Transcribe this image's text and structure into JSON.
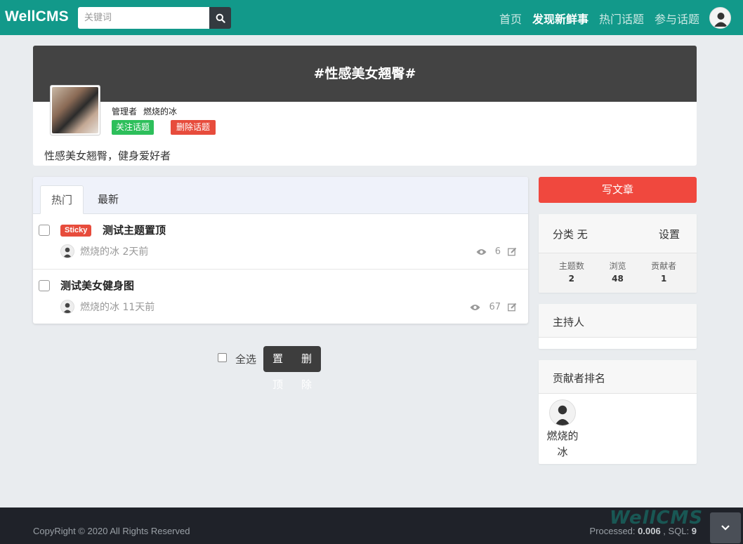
{
  "nav": {
    "brand": "WellCMS",
    "search_placeholder": "关键词",
    "links": [
      "首页",
      "发现新鲜事",
      "热门话题",
      "参与话题"
    ]
  },
  "topic": {
    "title": "#性感美女翘臀#",
    "manager_label": "管理者",
    "manager_name": "燃烧的冰",
    "follow_label": "关注话题",
    "delete_label": "删除话题",
    "description": "性感美女翘臀，健身爱好者"
  },
  "tabs": [
    "热门",
    "最新"
  ],
  "threads": [
    {
      "sticky": "Sticky",
      "subject": "测试主题置顶",
      "author": "燃烧的冰",
      "time": "2天前",
      "views": "6"
    },
    {
      "subject": "测试美女健身图",
      "author": "燃烧的冰",
      "time": "11天前",
      "views": "67"
    }
  ],
  "bulk": {
    "select_all": "全选",
    "pin": "置顶",
    "delete": "删除"
  },
  "sidebar": {
    "write": "写文章",
    "category": "分类 无",
    "settings": "设置",
    "stats": [
      {
        "label": "主题数",
        "value": "2"
      },
      {
        "label": "浏览",
        "value": "48"
      },
      {
        "label": "贡献者",
        "value": "1"
      }
    ],
    "host_title": "主持人",
    "rank_title": "贡献者排名",
    "contributor": "燃烧的冰"
  },
  "footer": {
    "copyright": "CopyRight © 2020 All Rights Reserved",
    "processed_label": "Processed: ",
    "processed_value": "0.006",
    "sql_label": " , SQL: ",
    "sql_value": "9",
    "watermark": "WellCMS"
  },
  "colors": {
    "navbar": "#12998a",
    "banner": "#434343",
    "danger": "#e74c3c",
    "success": "#2dbf5b",
    "write": "#f0483e"
  }
}
